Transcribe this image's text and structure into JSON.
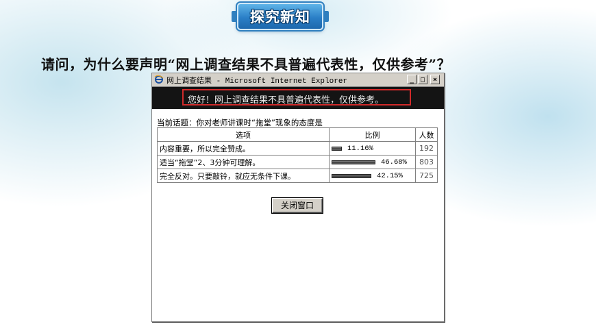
{
  "badge": {
    "label": "探究新知"
  },
  "question": "请问，为什么要声明“网上调查结果不具普遍代表性，仅供参考”？",
  "window": {
    "title": "网上调查结果 - Microsoft Internet Explorer",
    "controls": {
      "minimize": "_",
      "maximize": "□",
      "close": "×"
    },
    "banner": "您好！网上调查结果不具普遍代表性，仅供参考。",
    "topic": "当前话题：你对老师讲课时“拖堂”现象的态度是",
    "table": {
      "headers": [
        "选项",
        "比例",
        "人数"
      ],
      "rows": [
        {
          "option": "内容重要，所以完全赞成。",
          "ratio": 0.1116,
          "ratio_label": "11.16%",
          "count": "192"
        },
        {
          "option": "适当“拖堂”2、3分钟可理解。",
          "ratio": 0.4668,
          "ratio_label": "46.68%",
          "count": "803"
        },
        {
          "option": "完全反对。只要敲铃，就应无条件下课。",
          "ratio": 0.4215,
          "ratio_label": "42.15%",
          "count": "725"
        }
      ]
    },
    "close_button": "关闭窗口",
    "colors": {
      "banner_bg": "#141414",
      "banner_border": "#d12a2a",
      "chrome": "#d4d0c8"
    },
    "icons": {
      "app": "ie-icon"
    }
  }
}
